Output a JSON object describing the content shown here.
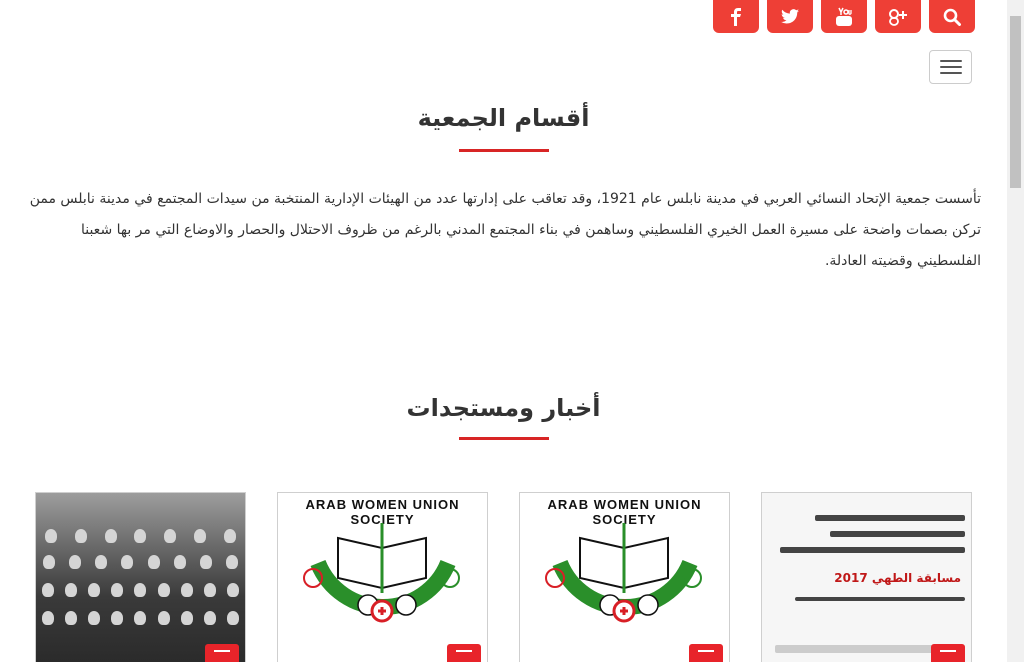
{
  "social": [
    {
      "name": "facebook-icon",
      "glyph": "f"
    },
    {
      "name": "twitter-icon",
      "glyph": "t"
    },
    {
      "name": "youtube-icon",
      "glyph": "You Tube"
    },
    {
      "name": "google-plus-icon",
      "glyph": "g+"
    },
    {
      "name": "search-icon",
      "glyph": "search"
    }
  ],
  "sections": {
    "departments_title": "أقسام الجمعية",
    "about_text": "تأسست جمعية الإتحاد النسائي العربي في مدينة نابلس عام 1921، وقد تعاقب على إدارتها عدد من الهيئات الإدارية المنتخبة من سيدات المجتمع في مدينة نابلس ممن تركن بصمات واضحة على مسيرة العمل الخيري الفلسطيني وساهمن في بناء المجتمع المدني بالرغم من ظروف الاحتلال والحصار والاوضاع التي مر بها شعبنا الفلسطيني وقضيته العادلة.",
    "news_title": "أخبار ومستجدات"
  },
  "news_cards": [
    {
      "kind": "photo"
    },
    {
      "kind": "logo",
      "logo_text": "ARAB WOMEN UNION SOCIETY"
    },
    {
      "kind": "logo",
      "logo_text": "ARAB WOMEN UNION SOCIETY"
    },
    {
      "kind": "poster",
      "poster_title": "مسابقة الطهي 2017"
    }
  ],
  "colors": {
    "accent": "#ee3f36",
    "title_line": "#d82525"
  }
}
